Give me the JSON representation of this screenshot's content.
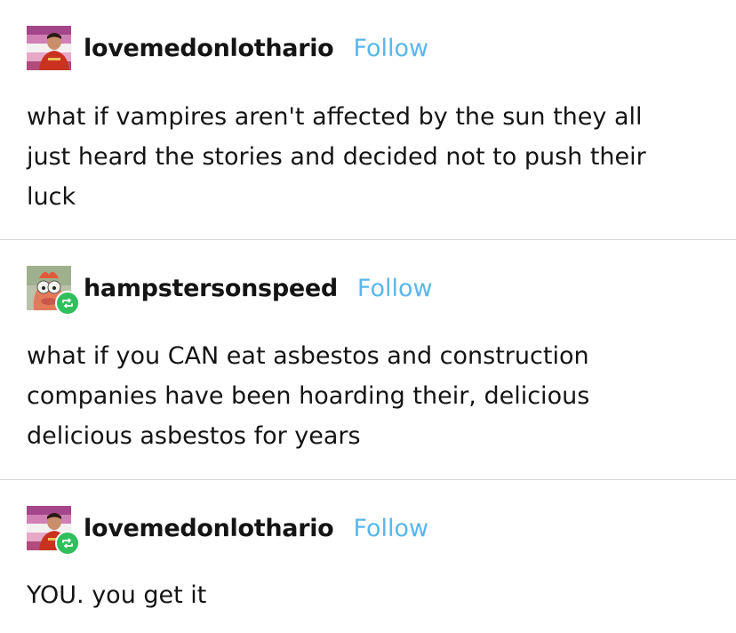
{
  "posts": [
    {
      "username": "lovemedonlothario",
      "follow_label": "Follow",
      "avatar": "pride-flag-avatar",
      "reblog_badge": false,
      "text": "what if vampires aren't affected by the sun they all\njust heard the stories and decided not to push their\nluck"
    },
    {
      "username": "hampstersonspeed",
      "follow_label": "Follow",
      "avatar": "muppet-avatar",
      "reblog_badge": true,
      "text": "what if you CAN eat asbestos and construction\ncompanies have been hoarding their, delicious\ndelicious asbestos for years"
    },
    {
      "username": "lovemedonlothario",
      "follow_label": "Follow",
      "avatar": "pride-flag-avatar",
      "reblog_badge": true,
      "text": "YOU. you get it"
    }
  ],
  "colors": {
    "follow": "#5bb6e8",
    "text": "#141414",
    "divider": "#d5d5d5",
    "reblog_badge": "#2fbf5b"
  }
}
